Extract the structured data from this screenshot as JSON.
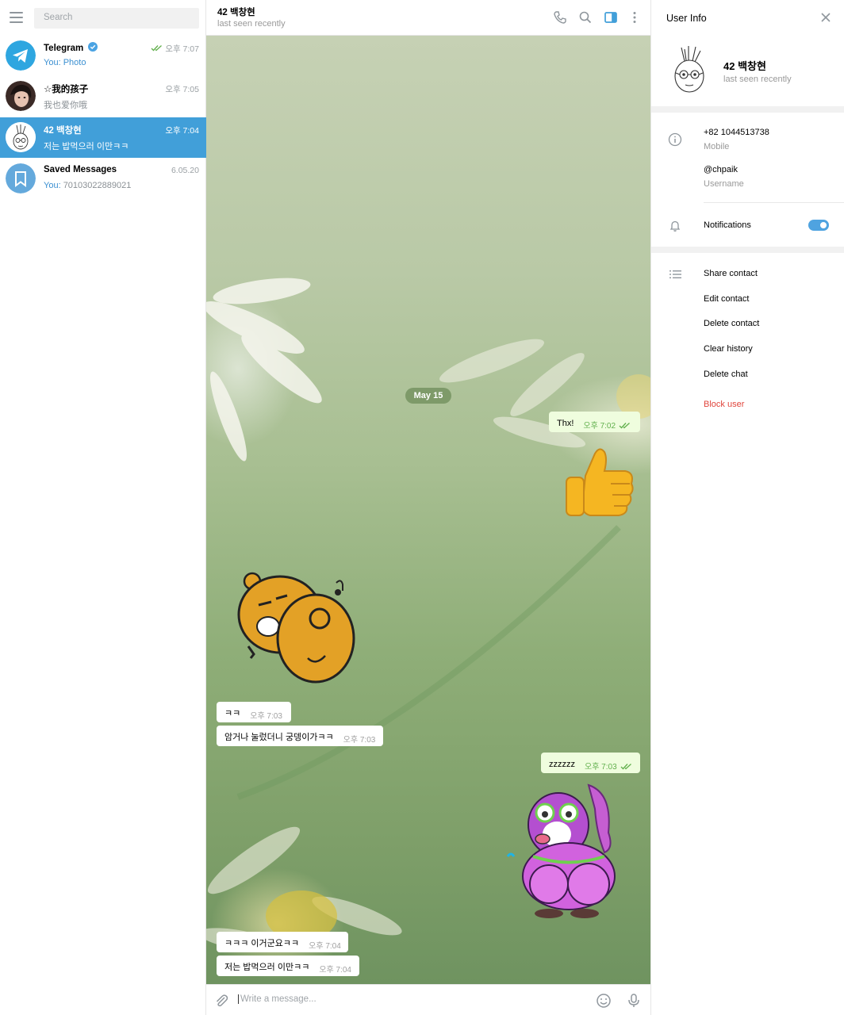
{
  "colors": {
    "accent": "#419fd9",
    "outgoing_bubble": "#effdde",
    "danger": "#e0453c",
    "check": "#62b04d"
  },
  "sidebar": {
    "search_placeholder": "Search",
    "chats": [
      {
        "name": "Telegram",
        "verified": true,
        "time": "오후 7:07",
        "read": true,
        "sender": "You:",
        "message": "Photo",
        "icon": "telegram-logo-icon"
      },
      {
        "name": "☆我的孩子",
        "time": "오후 7:05",
        "message": "我也爱你哦"
      },
      {
        "name": "42 백창현",
        "time": "오후 7:04",
        "message": "저는 밥먹으러 이만ㅋㅋ",
        "active": true
      },
      {
        "name": "Saved Messages",
        "time": "6.05.20",
        "sender": "You:",
        "message": "70103022889021",
        "icon": "bookmark-icon"
      }
    ]
  },
  "chat": {
    "header": {
      "name": "42 백창현",
      "status": "last seen recently"
    },
    "date_separator": "May 15",
    "messages": [
      {
        "dir": "out",
        "text": "Thx!",
        "time": "오후 7:02",
        "read": true
      },
      {
        "dir": "out",
        "sticker": "thumbs-up-sticker"
      },
      {
        "dir": "in",
        "sticker": "ryan-bear-sticker"
      },
      {
        "dir": "in",
        "text": "ㅋㅋ",
        "time": "오후 7:03"
      },
      {
        "dir": "in",
        "text": "암거나 눌렀더니 궁뎅이가ㅋㅋ",
        "time": "오후 7:03"
      },
      {
        "dir": "out",
        "text": "zzzzzz",
        "time": "오후 7:03",
        "read": true
      },
      {
        "dir": "out",
        "sticker": "pink-penguin-sticker"
      },
      {
        "dir": "in",
        "text": "ㅋㅋㅋ 이거군요ㅋㅋ",
        "time": "오후 7:04"
      },
      {
        "dir": "in",
        "text": "저는 밥먹으러 이만ㅋㅋ",
        "time": "오후 7:04"
      }
    ],
    "composer": {
      "placeholder": "Write a message..."
    }
  },
  "user_info": {
    "title": "User Info",
    "name": "42 백창현",
    "status": "last seen recently",
    "phone": "+82 1044513738",
    "phone_label": "Mobile",
    "username": "@chpaik",
    "username_label": "Username",
    "notifications_label": "Notifications",
    "notifications_on": true,
    "actions": [
      "Share contact",
      "Edit contact",
      "Delete contact",
      "Clear history",
      "Delete chat"
    ],
    "block_label": "Block user"
  }
}
